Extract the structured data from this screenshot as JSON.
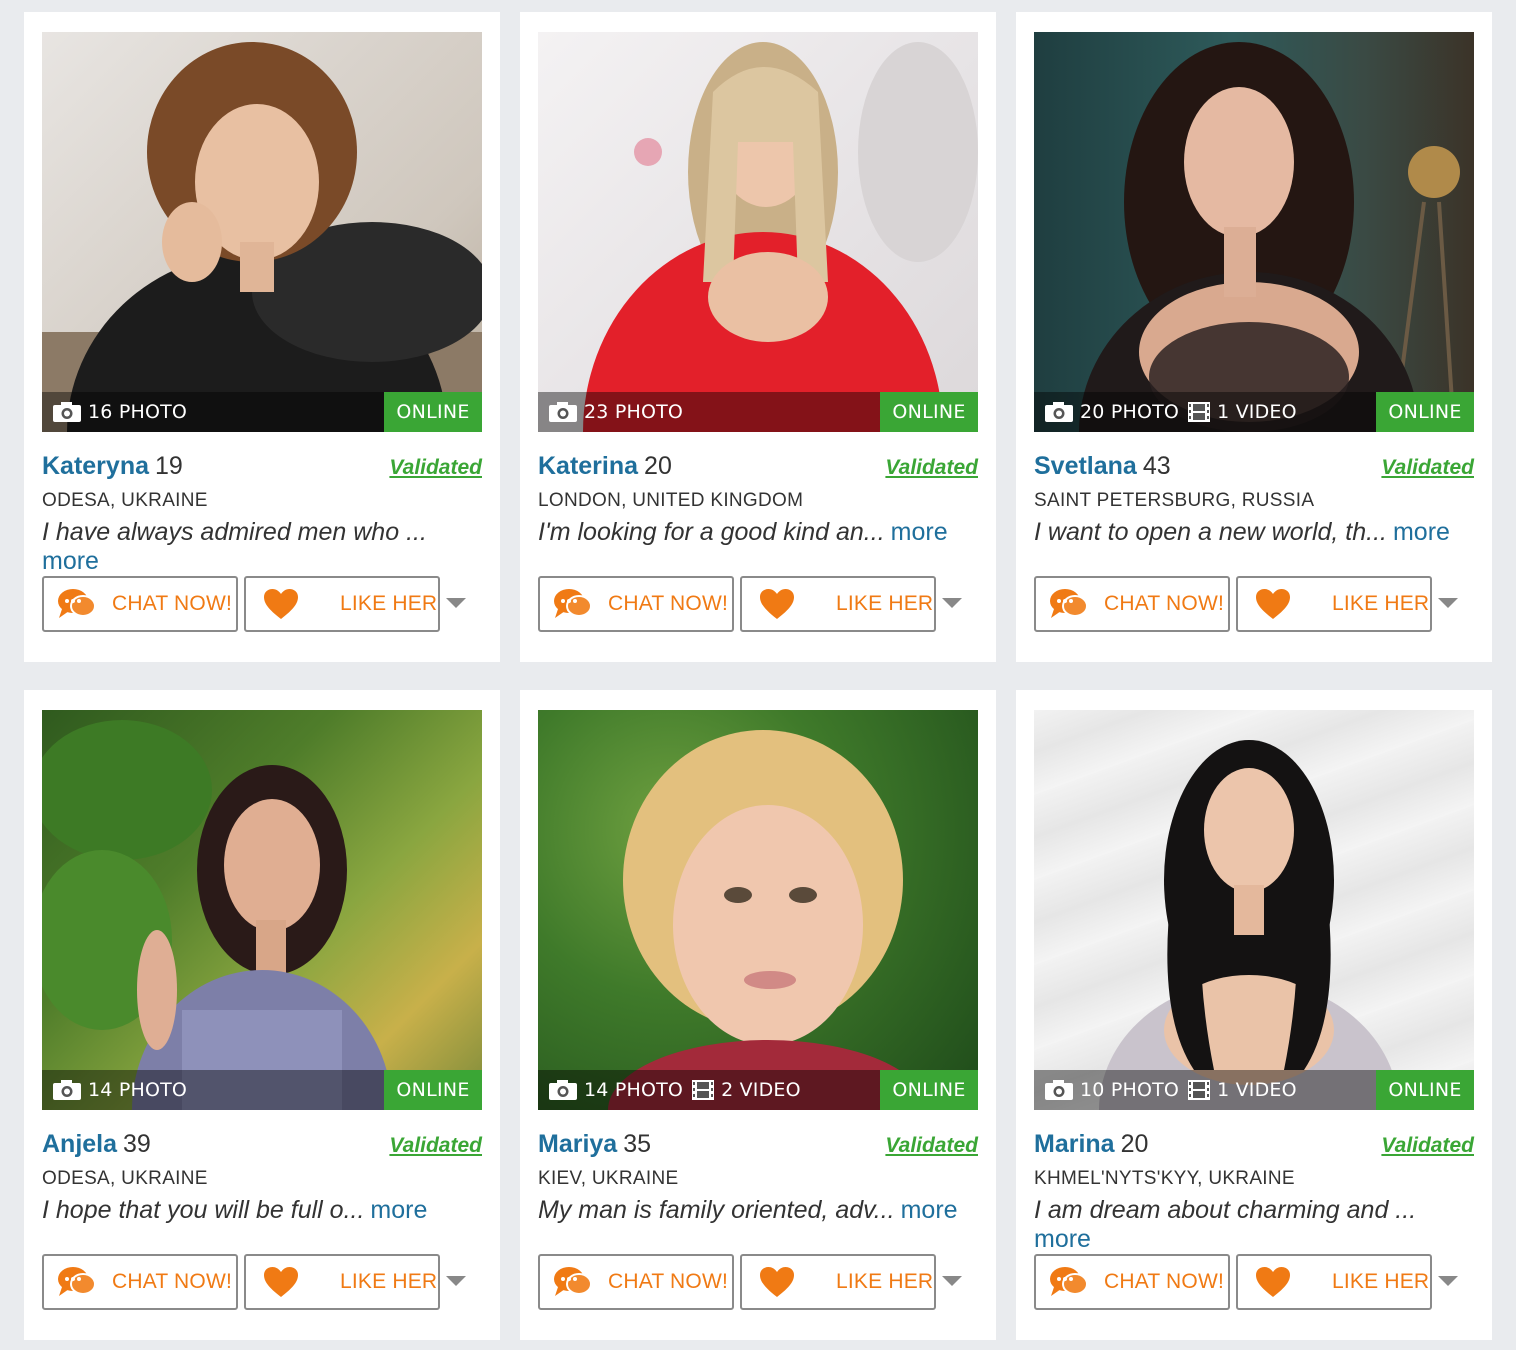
{
  "colors": {
    "name_blue": "#1f6f9c",
    "online_green": "#3aa635",
    "validated_green": "#3aa635",
    "action_orange": "#f07a14"
  },
  "profiles": [
    {
      "name": "Kateryna",
      "age": "19",
      "location": "ODESA, UKRAINE",
      "bio": "I have always admired men who ...",
      "more": "more",
      "photos": "16 PHOTO",
      "videos": "",
      "status": "ONLINE",
      "validated": "Validated",
      "chat_label": "CHAT NOW!",
      "like_label": "LIKE HER"
    },
    {
      "name": "Katerina",
      "age": "20",
      "location": "LONDON, UNITED KINGDOM",
      "bio": "I'm looking for a good kind an...",
      "more": "more",
      "photos": "23 PHOTO",
      "videos": "",
      "status": "ONLINE",
      "validated": "Validated",
      "chat_label": "CHAT NOW!",
      "like_label": "LIKE HER"
    },
    {
      "name": "Svetlana",
      "age": "43",
      "location": "SAINT PETERSBURG, RUSSIA",
      "bio": "I want to open a new world, th...",
      "more": "more",
      "photos": "20 PHOTO",
      "videos": "1 VIDEO",
      "status": "ONLINE",
      "validated": "Validated",
      "chat_label": "CHAT NOW!",
      "like_label": "LIKE HER"
    },
    {
      "name": "Anjela",
      "age": "39",
      "location": "ODESA, UKRAINE",
      "bio": "I hope that you will be full o...",
      "more": "more",
      "photos": "14 PHOTO",
      "videos": "",
      "status": "ONLINE",
      "validated": "Validated",
      "chat_label": "CHAT NOW!",
      "like_label": "LIKE HER"
    },
    {
      "name": "Mariya",
      "age": "35",
      "location": "KIEV, UKRAINE",
      "bio": "My man is family oriented, adv...",
      "more": "more",
      "photos": "14 PHOTO",
      "videos": "2 VIDEO",
      "status": "ONLINE",
      "validated": "Validated",
      "chat_label": "CHAT NOW!",
      "like_label": "LIKE HER"
    },
    {
      "name": "Marina",
      "age": "20",
      "location": "KHMEL'NYTS'KYY, UKRAINE",
      "bio": "I am dream about charming and ...",
      "more": "more",
      "photos": "10 PHOTO",
      "videos": "1 VIDEO",
      "status": "ONLINE",
      "validated": "Validated",
      "chat_label": "CHAT NOW!",
      "like_label": "LIKE HER"
    }
  ]
}
